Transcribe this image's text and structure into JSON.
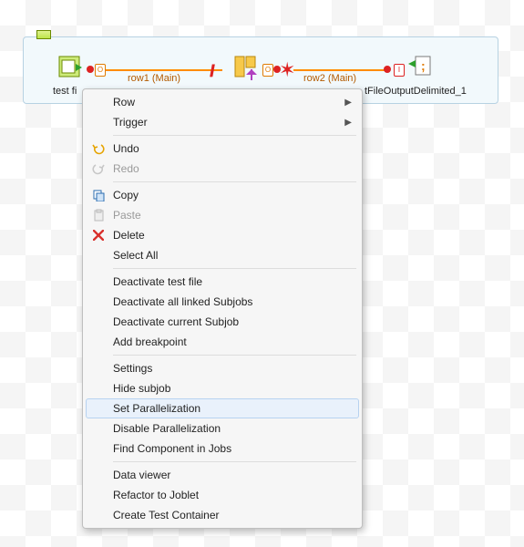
{
  "canvas": {
    "components": {
      "input": {
        "label": "test fi",
        "name": "file-input-component"
      },
      "map": {
        "label": "",
        "name": "tmap-component"
      },
      "output": {
        "label": "tFileOutputDelimited_1",
        "name": "file-output-component"
      }
    },
    "connections": {
      "row1": {
        "label": "row1 (Main)"
      },
      "row2": {
        "label": "row2 (Main)"
      }
    },
    "port_letter": "O"
  },
  "menu": {
    "row": "Row",
    "trigger": "Trigger",
    "undo": "Undo",
    "redo": "Redo",
    "copy": "Copy",
    "paste": "Paste",
    "delete": "Delete",
    "select_all": "Select All",
    "deactivate_testfile": "Deactivate test file",
    "deactivate_linked": "Deactivate all linked Subjobs",
    "deactivate_current": "Deactivate current Subjob",
    "add_breakpoint": "Add breakpoint",
    "settings": "Settings",
    "hide_subjob": "Hide subjob",
    "set_parallel": "Set Parallelization",
    "disable_parallel": "Disable Parallelization",
    "find_component": "Find Component in Jobs",
    "data_viewer": "Data viewer",
    "refactor_joblet": "Refactor to Joblet",
    "create_test": "Create Test Container"
  },
  "colors": {
    "accent_orange": "#ff8c00",
    "menu_hover": "#e9f1fb"
  }
}
